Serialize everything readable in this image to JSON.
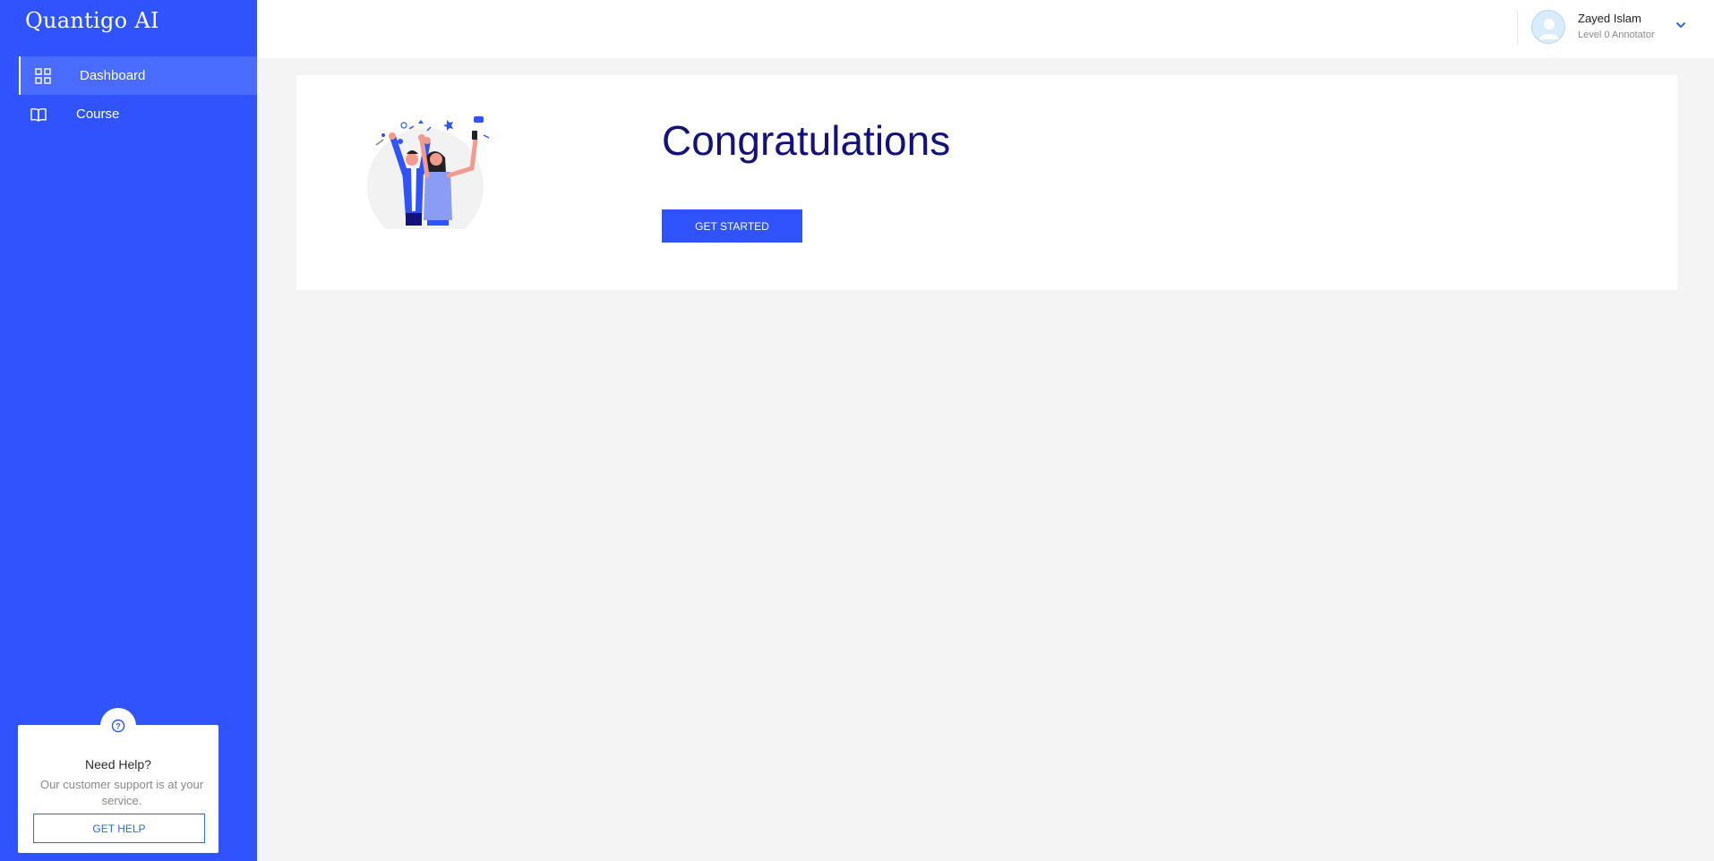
{
  "app": {
    "logo": "Quantigo AI"
  },
  "sidebar": {
    "items": [
      {
        "label": "Dashboard",
        "icon": "grid-icon",
        "active": true
      },
      {
        "label": "Course",
        "icon": "book-icon",
        "active": false
      }
    ]
  },
  "help": {
    "icon": "question-circle-icon",
    "title": "Need Help?",
    "text": "Our customer support is at your service.",
    "button": "GET HELP"
  },
  "header": {
    "user": {
      "name": "Zayed Islam",
      "role": "Level 0 Annotator",
      "avatar_icon": "user-avatar-icon"
    },
    "menu_icon": "chevron-down-icon"
  },
  "main": {
    "title": "Congratulations",
    "button": "GET STARTED",
    "illustration": "celebration-illustration"
  },
  "colors": {
    "brand": "#2f54fe",
    "title": "#14127a",
    "background": "#f4f4f4"
  }
}
